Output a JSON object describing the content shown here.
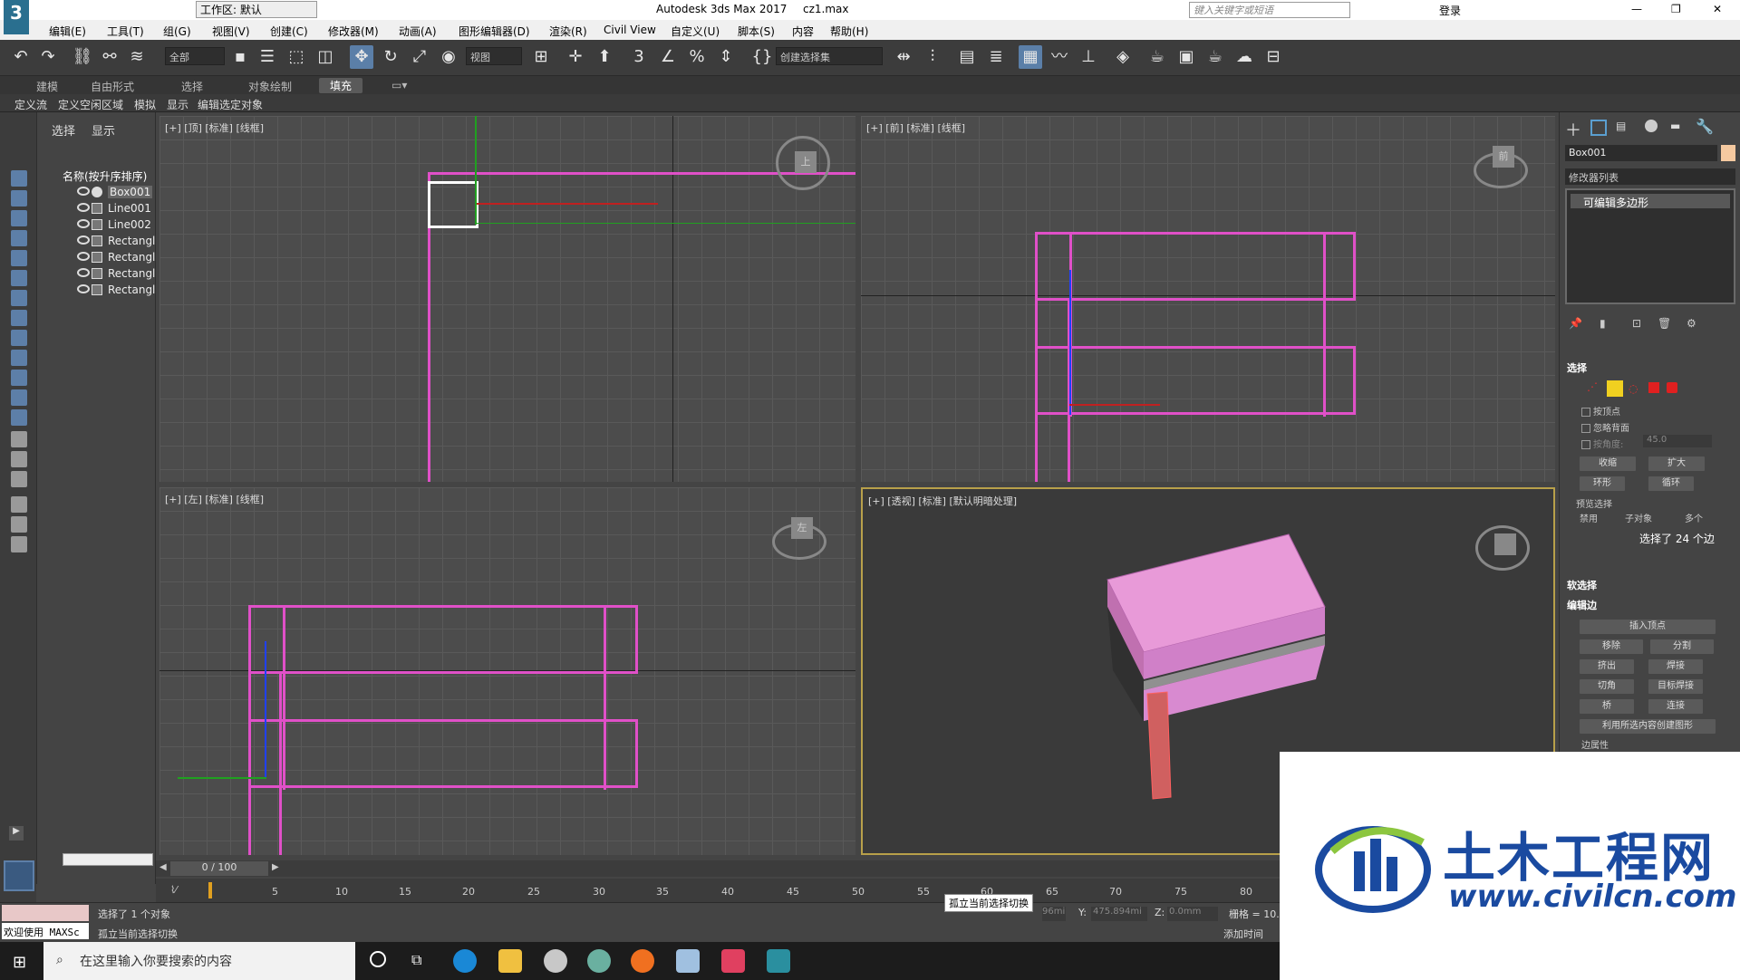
{
  "window": {
    "title": "Autodesk 3ds Max 2017",
    "file": "cz1.max",
    "workspace": "工作区: 默认",
    "search_placeholder": "键入关键字或短语",
    "login": "登录"
  },
  "menu": [
    "编辑(E)",
    "工具(T)",
    "组(G)",
    "视图(V)",
    "创建(C)",
    "修改器(M)",
    "动画(A)",
    "图形编辑器(D)",
    "渲染(R)",
    "Civil View",
    "自定义(U)",
    "脚本(S)",
    "内容",
    "帮助(H)"
  ],
  "toolbar": {
    "filter": "全部",
    "view": "视图",
    "named_sel": "创建选择集"
  },
  "ribbon_tabs": [
    "建模",
    "自由形式",
    "选择",
    "对象绘制",
    "填充"
  ],
  "sub_tabs": [
    "定义流",
    "定义空闲区域",
    "模拟",
    "显示",
    "编辑选定对象"
  ],
  "scene": {
    "tab_select": "选择",
    "tab_display": "显示",
    "col_header": "名称(按升序排序)",
    "items": [
      "Box001",
      "Line001",
      "Line002",
      "Rectangl",
      "Rectangl",
      "Rectangl",
      "Rectangl"
    ]
  },
  "viewports": {
    "top": "[+] [顶] [标准] [线框]",
    "front": "[+] [前] [标准] [线框]",
    "left": "[+] [左] [标准] [线框]",
    "persp": "[+] [透视] [标准] [默认明暗处理]",
    "top_cube": "上",
    "front_cube": "前",
    "left_cube": "左"
  },
  "command": {
    "object_name": "Box001",
    "modifier_list": "修改器列表",
    "stack_item": "可编辑多边形",
    "selection_header": "选择",
    "by_vertex": "按顶点",
    "ignore_back": "忽略背面",
    "by_angle": "按角度:",
    "angle_value": "45.0",
    "shrink": "收缩",
    "grow": "扩大",
    "ring": "环形",
    "loop": "循环",
    "preview_sel": "预览选择",
    "disabled": "禁用",
    "subobj": "子对象",
    "multi": "多个",
    "sel_status": "选择了 24 个边",
    "soft_sel": "软选择",
    "edit_edges": "编辑边",
    "insert_vertex": "插入顶点",
    "remove": "移除",
    "split": "分割",
    "extrude": "挤出",
    "weld": "焊接",
    "chamfer": "切角",
    "target_weld": "目标焊接",
    "bridge": "桥",
    "connect": "连接",
    "create_shape": "利用所选内容创建图形",
    "edge_props": "边属性"
  },
  "time": {
    "frame": "0 / 100",
    "ticks": [
      "0",
      "5",
      "10",
      "15",
      "20",
      "25",
      "30",
      "35",
      "40",
      "45",
      "50",
      "55",
      "60",
      "65",
      "70",
      "75",
      "80"
    ]
  },
  "status": {
    "welcome": "欢迎使用 MAXSc",
    "selected": "选择了 1 个对象",
    "isolate_hint": "孤立当前选择切换",
    "tooltip": "孤立当前选择切换",
    "x_val": "96mi",
    "y_label": "Y:",
    "y_val": "475.894mi",
    "z_label": "Z:",
    "z_val": "0.0mm",
    "grid": "栅格 = 10.",
    "add_time": "添加时间"
  },
  "taskbar": {
    "search": "在这里输入你要搜索的内容"
  },
  "watermark": {
    "name": "土木工程网",
    "url": "www.civilcn.com"
  }
}
